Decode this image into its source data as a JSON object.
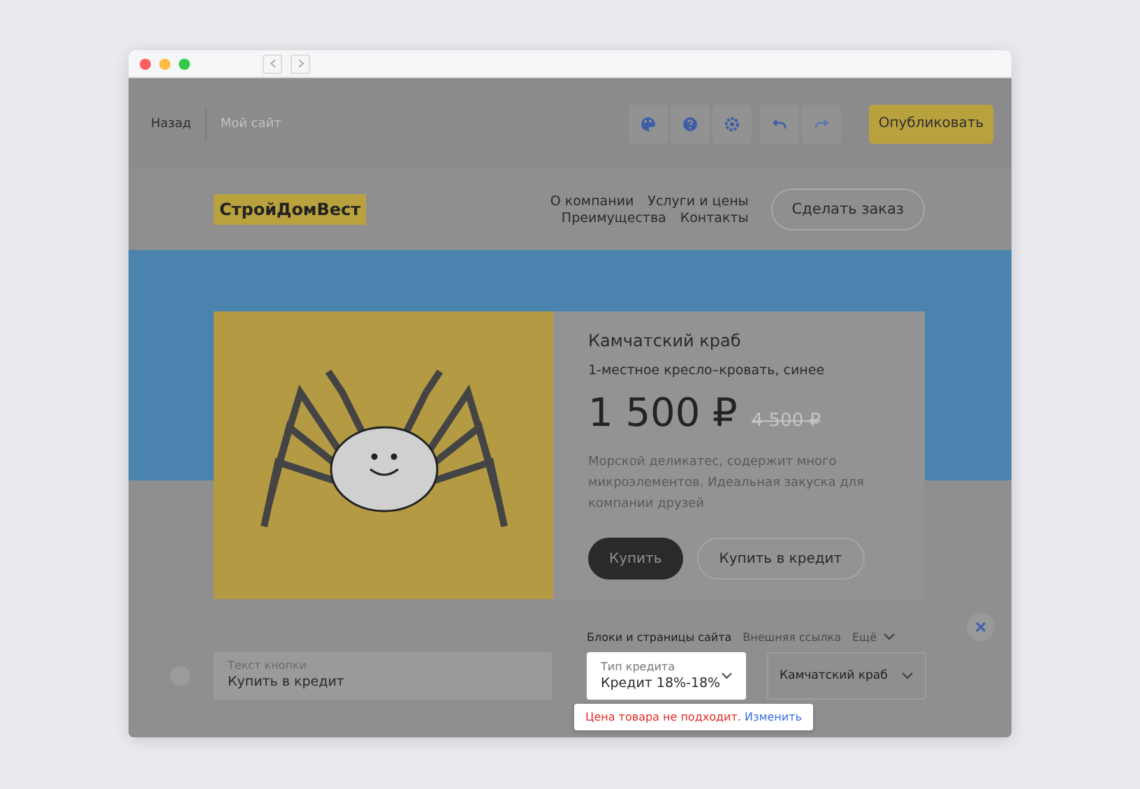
{
  "toolbar": {
    "back": "Назад",
    "site_name": "Мой сайт",
    "publish": "Опубликовать"
  },
  "site_header": {
    "logo": "СтройДомВест",
    "nav": [
      "О компании",
      "Услуги и цены",
      "Преимущества",
      "Контакты"
    ],
    "order_button": "Сделать заказ"
  },
  "product": {
    "title": "Камчатский краб",
    "subtitle": "1-местное кресло–кровать, синее",
    "price": "1 500 ₽",
    "old_price": "4 500 ₽",
    "description": "Морской деликатес, содержит много микроэлементов. Идеальная закуска для компании друзей",
    "buttons": [
      {
        "label": "Купить",
        "kind": "primary"
      },
      {
        "label": "Купить в кредит",
        "kind": "outline"
      }
    ]
  },
  "button_editor": {
    "radio_selected": false,
    "text_field": {
      "label": "Текст кнопки",
      "value": "Купить в кредит"
    },
    "link_tabs": [
      {
        "label": "Блоки и страницы сайта",
        "selected": true
      },
      {
        "label": "Внешняя ссылка",
        "selected": false
      },
      {
        "label": "Ещё",
        "selected": false
      }
    ],
    "credit_select": {
      "label": "Тип кредита",
      "value": "Кредит 18%-18%"
    },
    "product_select": {
      "value": "Камчатский краб"
    },
    "warning": {
      "message": "Цена товара не подходит.",
      "link": "Изменить"
    }
  }
}
